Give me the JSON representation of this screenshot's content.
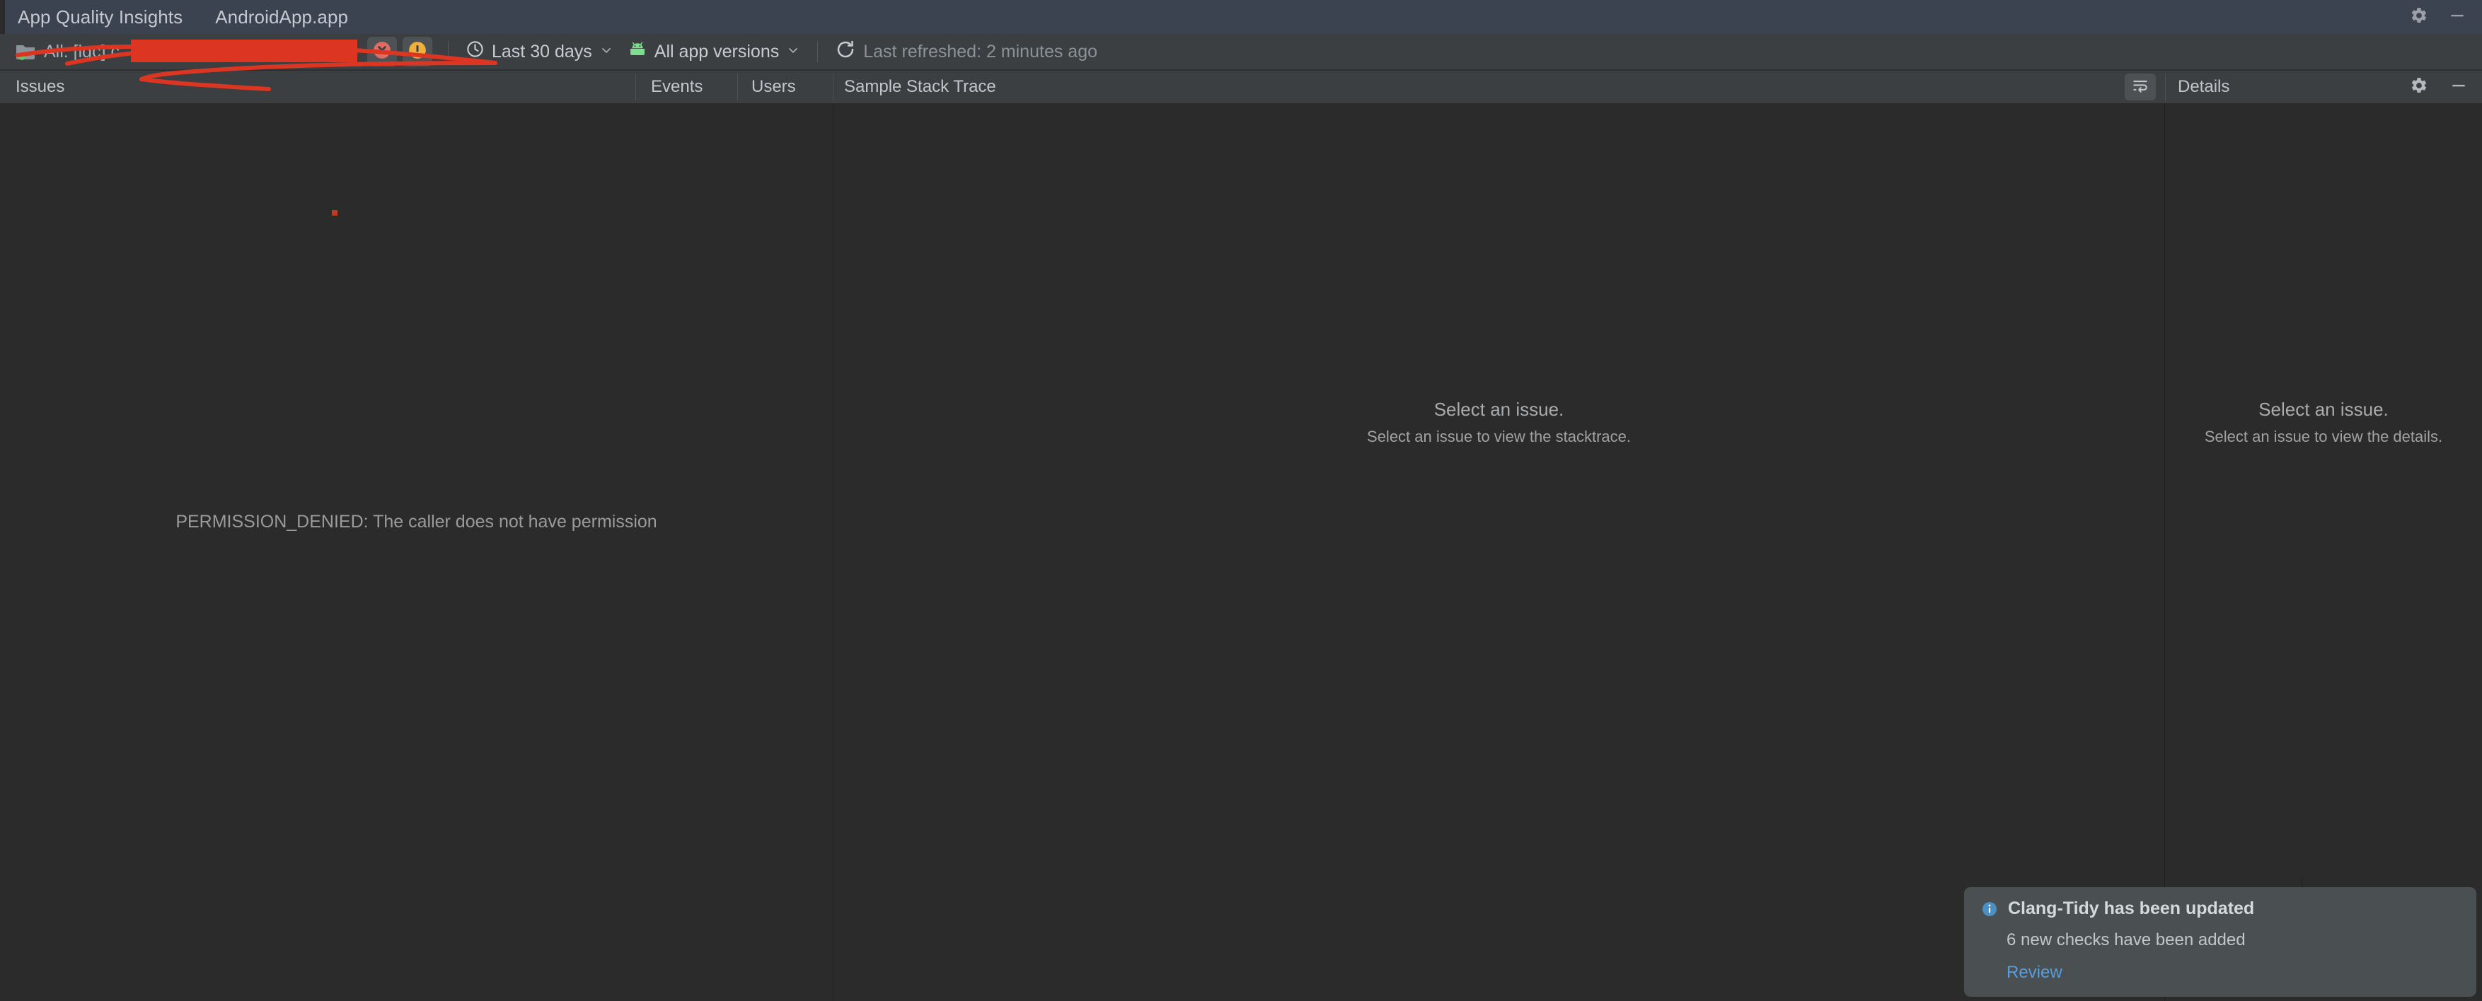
{
  "window": {
    "tool_window_tabs": [
      {
        "label": "App Quality Insights",
        "active": true
      },
      {
        "label": "AndroidApp.app",
        "active": false
      }
    ],
    "settings_icon": "gear-icon",
    "minimize_icon": "minimize-icon"
  },
  "toolbar": {
    "app_selector": {
      "icon": "android-app-module-icon",
      "value": "All: [lgc] c",
      "redacted": true,
      "chevron": "chevron-down-icon"
    },
    "severity_filters": [
      {
        "name": "fatal-crash-filter",
        "icon": "error-circle-x-icon",
        "color": "#e06c64",
        "active": true
      },
      {
        "name": "non-fatal-filter",
        "icon": "warning-exclamation-icon",
        "color": "#f0b03a",
        "active": true
      }
    ],
    "time_range": {
      "icon": "clock-icon",
      "label": "Last 30 days",
      "chevron": "chevron-down-icon"
    },
    "app_versions": {
      "icon": "android-robot-icon",
      "label": "All app versions",
      "chevron": "chevron-down-icon"
    },
    "refresh": {
      "icon": "refresh-icon",
      "status": "Last refreshed: 2 minutes ago"
    }
  },
  "panel_headers": {
    "issues": "Issues",
    "events": "Events",
    "users": "Users",
    "sample_stack_trace": "Sample Stack Trace",
    "details": "Details",
    "stack_toggle_icon": "soft-wrap-icon",
    "details_settings_icon": "gear-icon",
    "details_minimize_icon": "minimize-icon"
  },
  "issues_pane": {
    "error_message": "PERMISSION_DENIED: The caller does not have permission"
  },
  "stacktrace_pane": {
    "title": "Select an issue.",
    "subtitle": "Select an issue to view the stacktrace."
  },
  "details_pane": {
    "title": "Select an issue.",
    "subtitle": "Select an issue to view the details."
  },
  "notification": {
    "icon": "info-icon",
    "title": "Clang-Tidy has been updated",
    "body": "6 new checks have been added",
    "action_label": "Review",
    "link_color": "#5b9dd9"
  },
  "theme": {
    "window_bg": "#2b2b2b",
    "toolbar_bg": "#3c3f41",
    "titlebar_bg": "#3c4350",
    "text_primary": "#c5c9cf",
    "text_muted": "#8d9297",
    "redaction_color": "#dc3522",
    "accent_green": "#62c462"
  }
}
